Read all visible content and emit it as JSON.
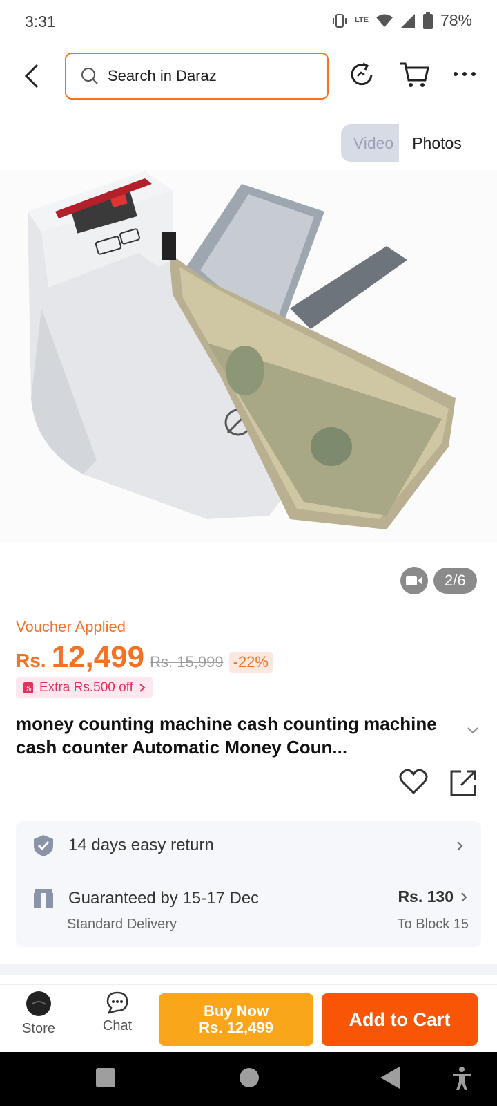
{
  "status_bar": {
    "time": "3:31",
    "battery": "78%",
    "net_label": "LTE"
  },
  "search": {
    "placeholder": "Search in Daraz"
  },
  "media_toggle": {
    "video": "Video",
    "photos": "Photos"
  },
  "gallery": {
    "counter": "2/6"
  },
  "price": {
    "voucher": "Voucher Applied",
    "currency": "Rs.",
    "current": "12,499",
    "original": "Rs. 15,999",
    "discount": "-22%",
    "extra": "Extra Rs.500 off"
  },
  "product": {
    "title": "money counting machine cash counting machine cash counter Automatic Money Coun..."
  },
  "services": {
    "return": "14 days easy return",
    "delivery": "Guaranteed by 15-17 Dec",
    "delivery_sub": "Standard Delivery",
    "shipping_fee": "Rs. 130",
    "destination": "To Block 15"
  },
  "bottom_bar": {
    "store": "Store",
    "chat": "Chat",
    "buy_now": "Buy Now",
    "buy_now_price": "Rs. 12,499",
    "add_to_cart": "Add to Cart"
  },
  "colors": {
    "accent": "#f57224",
    "buy_now": "#faa61a",
    "add_to_cart": "#f85606"
  }
}
